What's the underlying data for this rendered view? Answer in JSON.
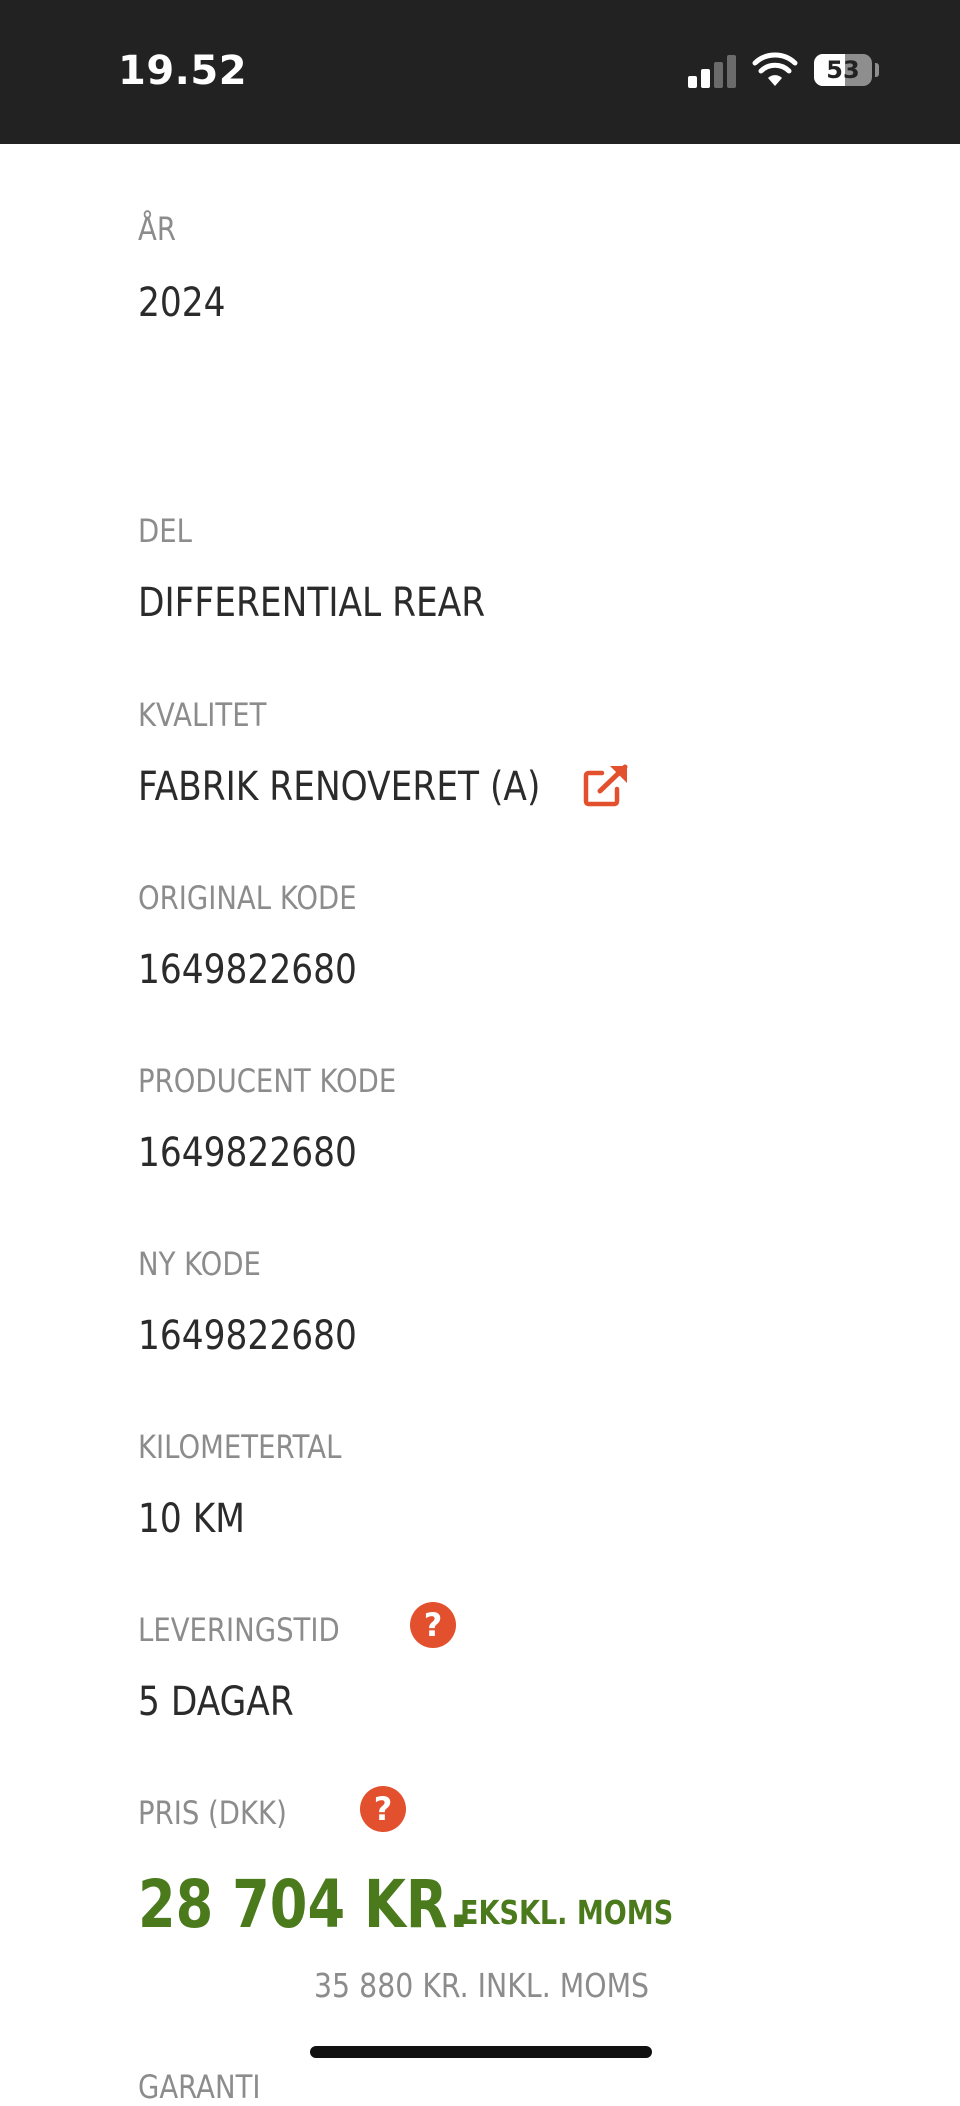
{
  "status_bar": {
    "time": "19.52",
    "battery_percent": "53",
    "signal_bars_active": 2,
    "signal_bars_total": 4
  },
  "fields": {
    "year": {
      "label": "ÅR",
      "value": "2024"
    },
    "part": {
      "label": "DEL",
      "value": "DIFFERENTIAL REAR"
    },
    "quality": {
      "label": "KVALITET",
      "value": "FABRIK RENOVERET (A)"
    },
    "original_code": {
      "label": "ORIGINAL KODE",
      "value": "1649822680"
    },
    "producer_code": {
      "label": "PRODUCENT KODE",
      "value": "1649822680"
    },
    "new_code": {
      "label": "NY KODE",
      "value": "1649822680"
    },
    "mileage": {
      "label": "KILOMETERTAL",
      "value": "10 KM"
    },
    "delivery": {
      "label": "LEVERINGSTID",
      "value": "5 DAGAR"
    },
    "price": {
      "label": "PRIS  (DKK)"
    }
  },
  "price": {
    "excl_amount": "28 704 KR.",
    "excl_suffix": "EKSKL. MOMS",
    "incl": "35 880 KR. INKL. MOMS"
  },
  "next_label_partial": "GARANTI",
  "icons": {
    "help": "question-circle-icon",
    "external_link": "external-link-icon",
    "accent_color": "#e2502e",
    "price_color": "#4a7a1c"
  }
}
